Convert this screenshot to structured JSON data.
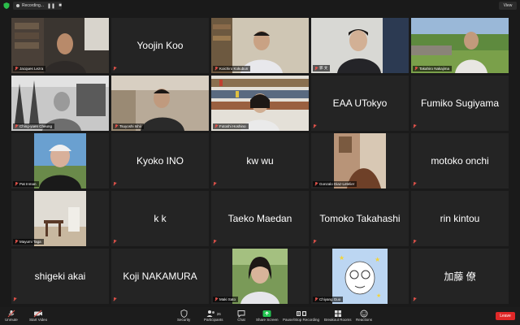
{
  "topbar": {
    "recording_label": "Recording...",
    "view_label": "View"
  },
  "tiles": [
    {
      "name": "Jacques Lezra",
      "video": true
    },
    {
      "name": "Yoojin Koo",
      "video": false
    },
    {
      "name": "Koichiro Kokubun",
      "video": true
    },
    {
      "name": "郭 文",
      "video": true,
      "active": true
    },
    {
      "name": "Takahiro Nakajima",
      "video": true
    },
    {
      "name": "Ching-yuen Cheung",
      "video": true
    },
    {
      "name": "Tsuyoshi Ishii",
      "video": true
    },
    {
      "name": "Futoshi Hoshino",
      "video": true
    },
    {
      "name": "EAA UTokyo",
      "video": false
    },
    {
      "name": "Fumiko Sugiyama",
      "video": false
    },
    {
      "name": "Pat Inman",
      "video": true
    },
    {
      "name": "Kyoko INO",
      "video": false
    },
    {
      "name": "kw wu",
      "video": false
    },
    {
      "name": "Gonzalo Diaz-Letelier",
      "video": true
    },
    {
      "name": "motoko onchi",
      "video": false
    },
    {
      "name": "Mayumi Taga",
      "video": true
    },
    {
      "name": "k k",
      "video": false
    },
    {
      "name": "Taeko Maedan",
      "video": false
    },
    {
      "name": "Tomoko Takahashi",
      "video": false
    },
    {
      "name": "rin kintou",
      "video": false
    },
    {
      "name": "shigeki akai",
      "video": false
    },
    {
      "name": "Koji NAKAMURA",
      "video": false
    },
    {
      "name": "Maki Sato",
      "video": true
    },
    {
      "name": "Chiyang Guo",
      "video": true
    },
    {
      "name": "加藤 僚",
      "video": false
    }
  ],
  "toolbar": {
    "unmute": "Unmute",
    "start_video": "Start Video",
    "security": "Security",
    "participants": "Participants",
    "participants_count": "26",
    "chat": "Chat",
    "share_screen": "Share Screen",
    "pause_recording": "Pause/Stop Recording",
    "breakout_rooms": "Breakout Rooms",
    "reactions": "Reactions",
    "leave": "Leave"
  },
  "colors": {
    "active_border": "#b7dd6b",
    "leave": "#e02828",
    "share": "#23c551"
  }
}
